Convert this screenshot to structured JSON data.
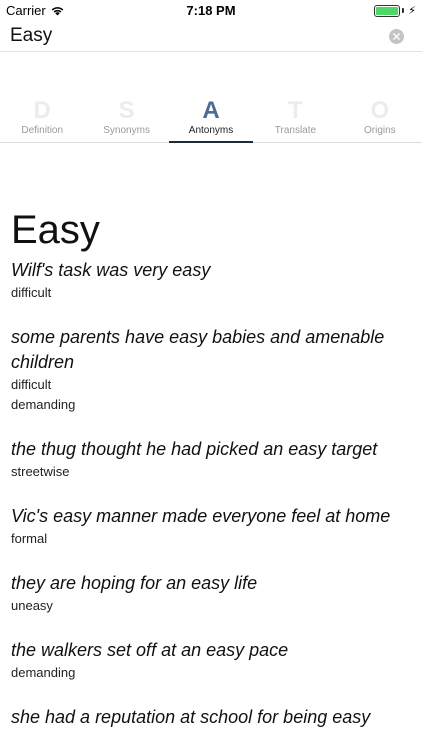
{
  "status_bar": {
    "carrier": "Carrier",
    "time": "7:18 PM",
    "battery_level": 1.0,
    "battery_color": "#4cd964"
  },
  "search": {
    "value": "Easy",
    "clear_icon": "clear-icon"
  },
  "tabs": [
    {
      "letter": "D",
      "label": "Definition",
      "active": false
    },
    {
      "letter": "S",
      "label": "Synonyms",
      "active": false
    },
    {
      "letter": "A",
      "label": "Antonyms",
      "active": true
    },
    {
      "letter": "T",
      "label": "Translate",
      "active": false
    },
    {
      "letter": "O",
      "label": "Origins",
      "active": false
    }
  ],
  "colors": {
    "active_tab_letter": "#4b6d95",
    "inactive_tab_letter": "#ececec",
    "tab_underline": "#1f2b3a"
  },
  "main": {
    "headword": "Easy",
    "entries": [
      {
        "example": "Wilf's task was very easy",
        "antonyms": [
          "difficult"
        ]
      },
      {
        "example": "some parents have easy babies and amenable children",
        "antonyms": [
          "difficult",
          "demanding"
        ]
      },
      {
        "example": "the thug thought he had picked an easy target",
        "antonyms": [
          "streetwise"
        ]
      },
      {
        "example": "Vic's easy manner made everyone feel at home",
        "antonyms": [
          "formal"
        ]
      },
      {
        "example": "they are hoping for an easy life",
        "antonyms": [
          "uneasy"
        ]
      },
      {
        "example": "the walkers set off at an easy pace",
        "antonyms": [
          "demanding"
        ]
      },
      {
        "example": "she had a reputation at school for being easy",
        "antonyms": []
      }
    ]
  }
}
